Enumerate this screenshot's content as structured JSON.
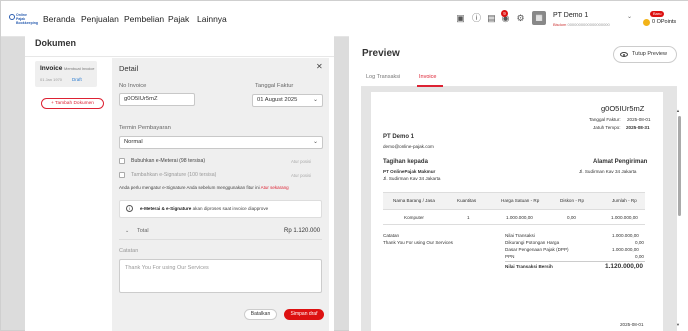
{
  "brand": {
    "logo_text": "Online Pajak Bookkeeping"
  },
  "nav": {
    "items": [
      "Beranda",
      "Penjualan",
      "Pembelian",
      "Pajak",
      "Lainnya"
    ]
  },
  "header": {
    "notif_count": "9",
    "company_name": "PT Demo 1",
    "company_badge": "Bisdom",
    "company_id": "0000000000000000000",
    "points_tag": "Baru",
    "points_value": "0 OPoints"
  },
  "documents": {
    "title": "Dokumen",
    "card": {
      "title": "Invoice",
      "subtitle": "Membuat Invoice",
      "date": "01 Jan 1970",
      "status": "Draft"
    },
    "add_button": "+ Tambah Dokumen"
  },
  "detail": {
    "title": "Detail",
    "invoice_no_label": "No Invoice",
    "invoice_no_value": "g0O5IUr5mZ",
    "tanggal_label": "Tanggal Faktur",
    "tanggal_value": "01 August 2025",
    "termin_label": "Termin Pembayaran",
    "termin_value": "Normal",
    "option1": "Bubuhkan e-Meterai (98 tersisa)",
    "option2": "Tambahkan e-Signature (100 tersisa)",
    "set_pos": "Atur posisi",
    "note_text": "Anda perlu mengatur e-Signature Anda sebelum menggunakan fitur ini",
    "note_link": "Atur sekarang",
    "info_bold": "e-Meterai & e-Signature",
    "info_rest": "akan diproses saat invoice diapprove",
    "total_label": "Total",
    "total_value": "Rp 1.120.000",
    "catatan_label": "Catatan",
    "catatan_value": "Thank You For using Our Services",
    "cancel": "Batalkan",
    "save": "Simpan draf"
  },
  "preview": {
    "title": "Preview",
    "close_btn": "Tutup Preview",
    "tabs": [
      "Log Transaksi",
      "Invoice"
    ],
    "invoice": {
      "number": "g0O5IUr5mZ",
      "tanggal_label": "Tanggal Faktur:",
      "tanggal_value": "2025-08-01",
      "jatuh_label": "Jatuh Tempo:",
      "jatuh_value": "2025-08-31",
      "seller": "PT Demo 1",
      "seller_email": "demo@online-pajak.com",
      "tagihan_label": "Tagihan kepada",
      "buyer": "PT OnlinePajak Makmur",
      "buyer_addr": "Jl. Sudirman Kav 34 Jakarta",
      "ship_label": "Alamat Pengiriman",
      "ship_addr": "Jl. Sudirman Kav 34 Jakarta",
      "columns": [
        "Nama Barang / Jasa",
        "Kuantitas",
        "Harga Satuan - Rp",
        "Diskon - Rp",
        "Jumlah - Rp"
      ],
      "rows": [
        [
          "Komputer",
          "1",
          "1.000.000,00",
          "0,00",
          "1.000.000,00"
        ]
      ],
      "catatan_label": "Catatan",
      "catatan_value": "Thank You For using Our Services",
      "summary": [
        [
          "Nilai Transaksi",
          "1.000.000,00"
        ],
        [
          "Dikurangi Potongan Harga",
          "0,00"
        ],
        [
          "Dasar Pengenaan Pajak (DPP)",
          "1.000.000,00"
        ],
        [
          "PPN",
          "0,00"
        ]
      ],
      "net_label": "Nilai Transaksi Bersih",
      "net_value": "1.120.000,00",
      "footer_date": "2025-08-01"
    }
  }
}
